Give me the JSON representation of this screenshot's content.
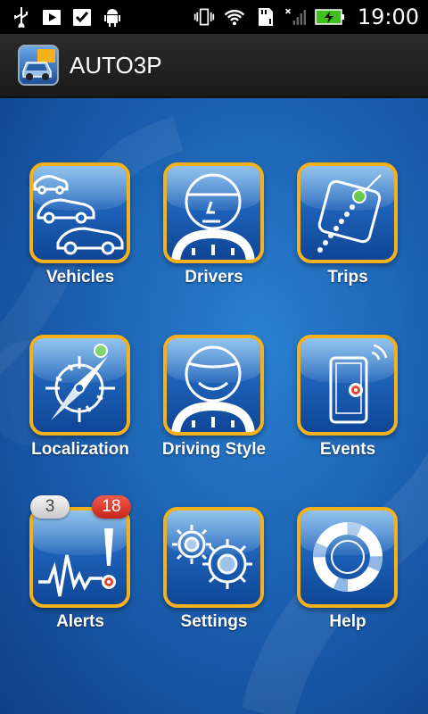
{
  "status_bar": {
    "time": "19:00",
    "left_icons": [
      "usb-icon",
      "play-store-icon",
      "task-check-icon",
      "android-icon"
    ],
    "right_icons": [
      "vibrate-icon",
      "wifi-icon",
      "sd-card-icon",
      "signal-icon",
      "battery-charging-icon"
    ]
  },
  "action_bar": {
    "title": "AUTO3P",
    "logo_icon": "car-map-logo"
  },
  "colors": {
    "tile_border": "#f4b11c",
    "background": "#1b5fb0",
    "badge_red": "#d9342a"
  },
  "tiles": [
    {
      "label": "Vehicles",
      "icon": "cars-icon"
    },
    {
      "label": "Drivers",
      "icon": "driver-face-icon"
    },
    {
      "label": "Trips",
      "icon": "trip-map-icon"
    },
    {
      "label": "Localization",
      "icon": "compass-icon"
    },
    {
      "label": "Driving Style",
      "icon": "smiling-driver-icon"
    },
    {
      "label": "Events",
      "icon": "phone-event-icon"
    },
    {
      "label": "Alerts",
      "icon": "alert-pulse-icon"
    },
    {
      "label": "Settings",
      "icon": "gears-icon"
    },
    {
      "label": "Help",
      "icon": "lifebuoy-icon"
    }
  ],
  "alerts_badges": {
    "gray_count": "3",
    "red_count": "18"
  }
}
